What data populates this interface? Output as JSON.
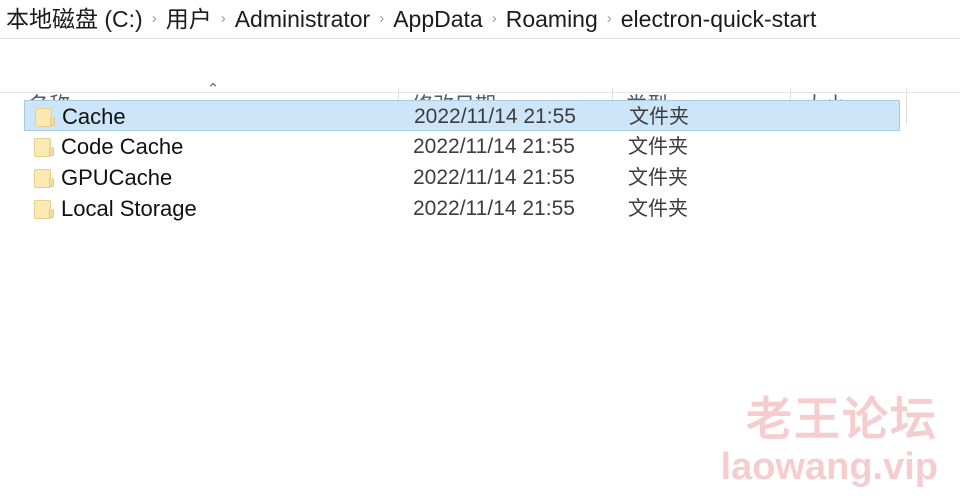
{
  "breadcrumb": {
    "separator": "›",
    "items": [
      {
        "label": "本地磁盘 (C:)"
      },
      {
        "label": "用户"
      },
      {
        "label": "Administrator"
      },
      {
        "label": "AppData"
      },
      {
        "label": "Roaming"
      },
      {
        "label": "electron-quick-start"
      }
    ]
  },
  "columns": {
    "sort_caret": "⌃",
    "name": "名称",
    "date_modified": "修改日期",
    "type": "类型",
    "size": "大小"
  },
  "files": [
    {
      "name": "Cache",
      "date_modified": "2022/11/14 21:55",
      "type": "文件夹",
      "size": "",
      "icon": "folder-icon",
      "selected": true
    },
    {
      "name": "Code Cache",
      "date_modified": "2022/11/14 21:55",
      "type": "文件夹",
      "size": "",
      "icon": "folder-icon",
      "selected": false
    },
    {
      "name": "GPUCache",
      "date_modified": "2022/11/14 21:55",
      "type": "文件夹",
      "size": "",
      "icon": "folder-icon",
      "selected": false
    },
    {
      "name": "Local Storage",
      "date_modified": "2022/11/14 21:55",
      "type": "文件夹",
      "size": "",
      "icon": "folder-icon",
      "selected": false
    }
  ],
  "watermark": {
    "line1": "老王论坛",
    "line2": "laowang.vip"
  },
  "colors": {
    "selection_fill": "#cde5f8",
    "selection_border": "#a8cbe4",
    "folder_yellow": "#fbe9b4",
    "header_text": "#4e5a66",
    "watermark": "#f6cdcf"
  }
}
